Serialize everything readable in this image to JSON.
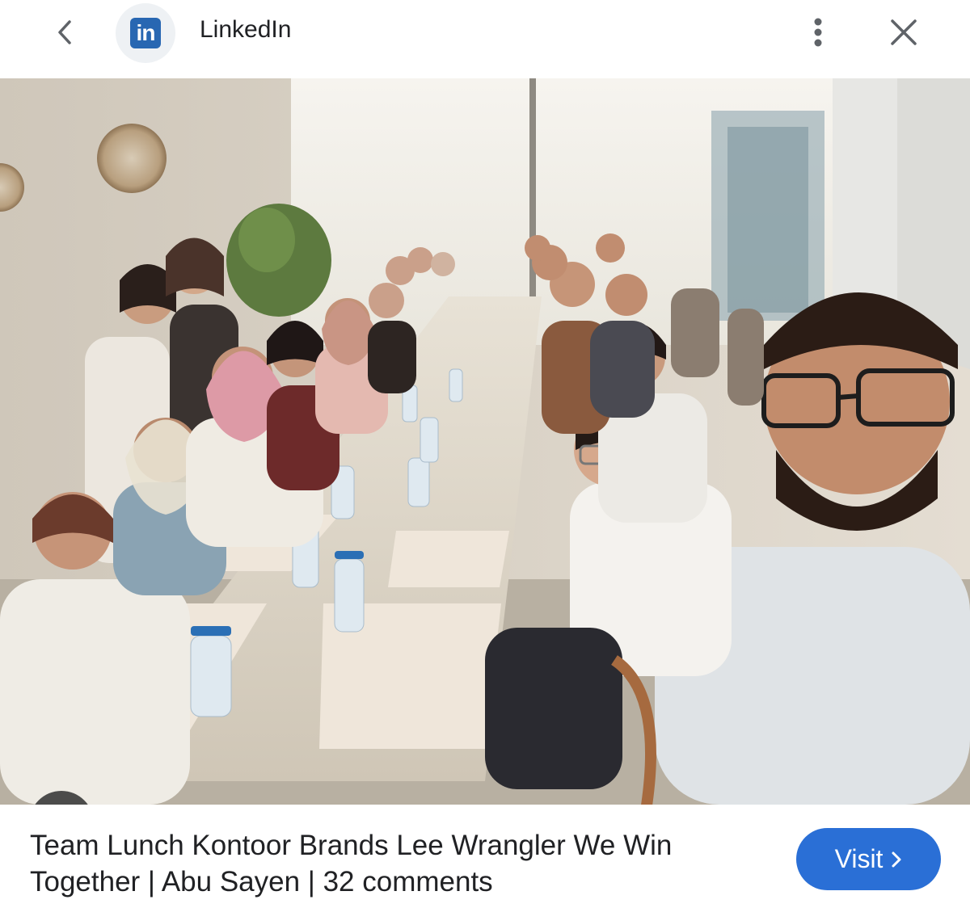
{
  "header": {
    "back_icon": "chevron-left-icon",
    "site_logo_text": "in",
    "site_name": "LinkedIn",
    "more_icon": "more-vert-icon",
    "close_icon": "close-icon"
  },
  "image": {
    "description_icon": "photo",
    "lens_icon": "google-lens-icon"
  },
  "result": {
    "title": "Team Lunch Kontoor Brands Lee Wrangler We Win Together | Abu Sayen | 32 comments",
    "visit_label": "Visit",
    "visit_icon": "chevron-right-icon"
  },
  "colors": {
    "linkedin_blue": "#2867b2",
    "visit_button": "#2a6fd6",
    "text": "#202124",
    "icon_gray": "#5f6368"
  }
}
